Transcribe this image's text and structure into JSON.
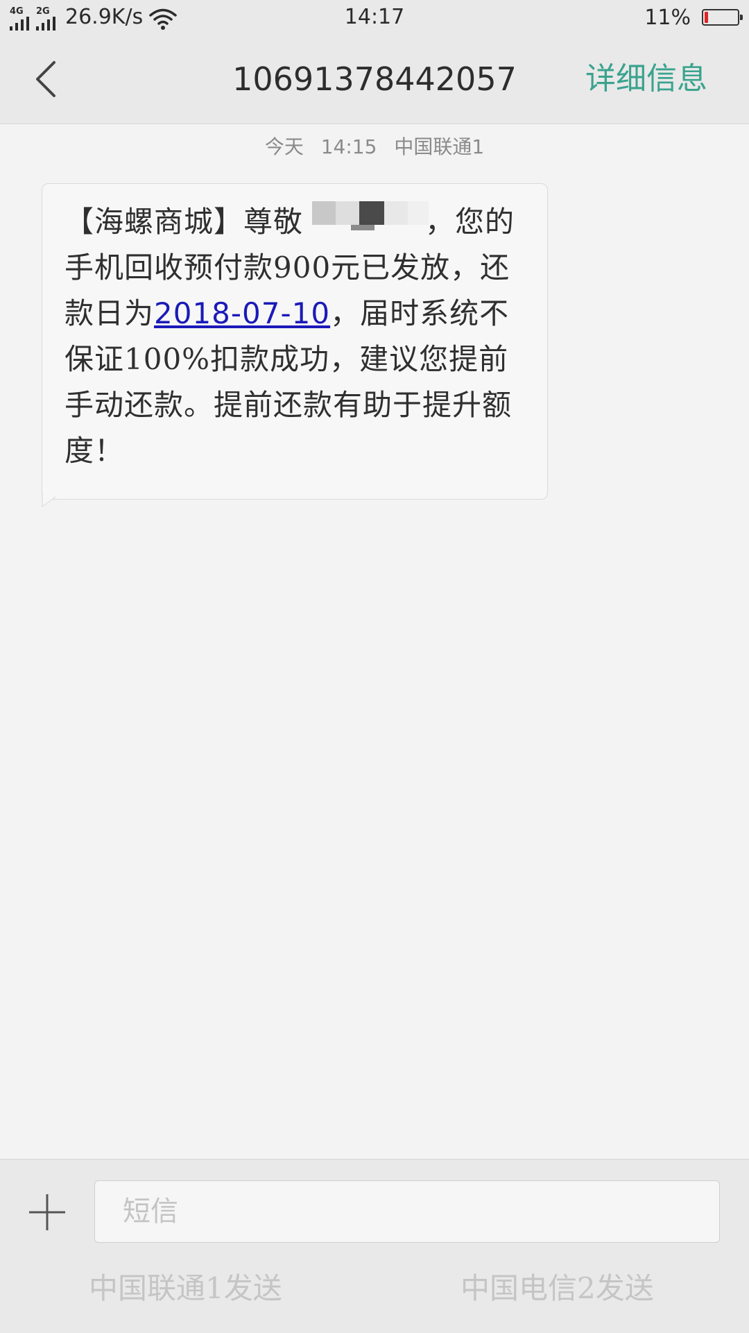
{
  "status_bar": {
    "network1": "4G",
    "network2": "2G",
    "speed": "26.9K/s",
    "time": "14:17",
    "battery_percent": "11%",
    "battery_level": 0.11,
    "battery_color": "#e02424"
  },
  "header": {
    "back_icon": "chevron-left-icon",
    "title": "10691378442057",
    "detail_label": "详细信息",
    "accent_color": "#3aa38e"
  },
  "conversation": {
    "timestamp_day": "今天",
    "timestamp_time": "14:15",
    "timestamp_carrier": "中国联通1",
    "message": {
      "part1": "【海螺商城】尊敬",
      "part2": "，您的手机回收预付款900元已发放，还款日为",
      "link_date": "2018-07-10",
      "part3": "，届时系统不保证100%扣款成功，建议您提前手动还款。提前还款有助于提升额度！",
      "link_color": "#1a1ab8"
    }
  },
  "composer": {
    "add_icon": "plus-icon",
    "placeholder": "短信",
    "value": "",
    "send_sim1_label": "中国联通1发送",
    "send_sim2_label": "中国电信2发送"
  }
}
